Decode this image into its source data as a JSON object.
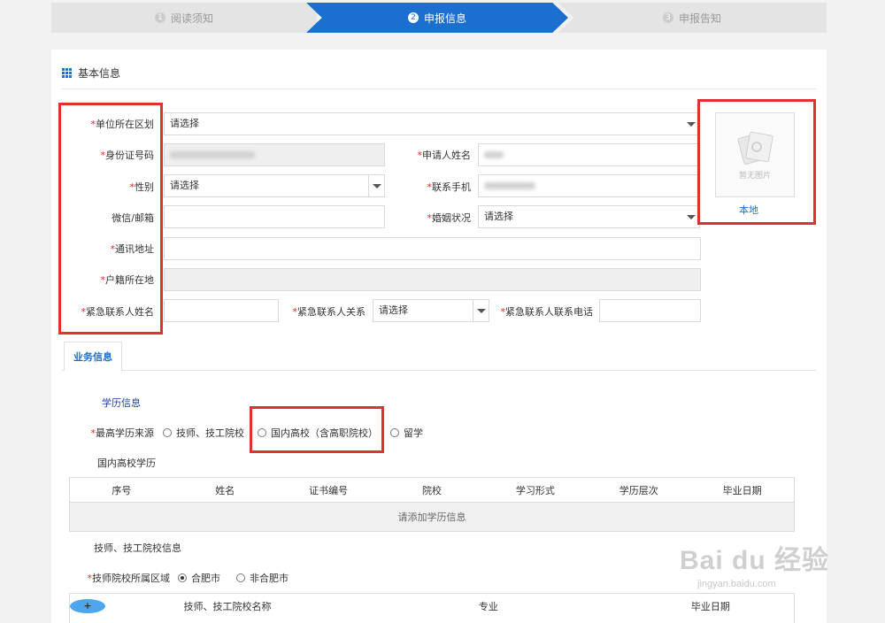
{
  "steps": [
    {
      "num": "1",
      "label": "阅读须知"
    },
    {
      "num": "2",
      "label": "申报信息"
    },
    {
      "num": "3",
      "label": "申报告知"
    }
  ],
  "section_title": "基本信息",
  "required_mark": "*",
  "form": {
    "region": {
      "label": "单位所在区划",
      "value": "请选择"
    },
    "id_number": {
      "label": "身份证号码"
    },
    "applicant_name": {
      "label": "申请人姓名"
    },
    "gender": {
      "label": "性别",
      "value": "请选择"
    },
    "phone": {
      "label": "联系手机"
    },
    "wechat_email": {
      "label": "微信/邮箱"
    },
    "marital": {
      "label": "婚姻状况",
      "value": "请选择"
    },
    "address": {
      "label": "通讯地址"
    },
    "household": {
      "label": "户籍所在地"
    },
    "emergency_name": {
      "label": "紧急联系人姓名"
    },
    "emergency_relation": {
      "label": "紧急联系人关系",
      "value": "请选择"
    },
    "emergency_phone": {
      "label": "紧急联系人联系电话"
    }
  },
  "photo": {
    "caption": "暂无图片",
    "link": "本地"
  },
  "tab": "业务信息",
  "education": {
    "title": "学历信息",
    "source_label": "最高学历来源",
    "options": [
      "技师、技工院校",
      "国内高校（含高职院校）",
      "留学"
    ],
    "domestic_title": "国内高校学历",
    "columns": [
      "序号",
      "姓名",
      "证书编号",
      "院校",
      "学习形式",
      "学历层次",
      "毕业日期"
    ],
    "empty_text": "请添加学历信息"
  },
  "technician": {
    "title": "技师、技工院校信息",
    "region_label": "技师院校所属区域",
    "region_options": [
      "合肥市",
      "非合肥市"
    ],
    "columns": [
      "技师、技工院校名称",
      "专业",
      "毕业日期"
    ]
  },
  "watermark": {
    "text": "Bai du 经验",
    "url": "jingyan.baidu.com"
  }
}
